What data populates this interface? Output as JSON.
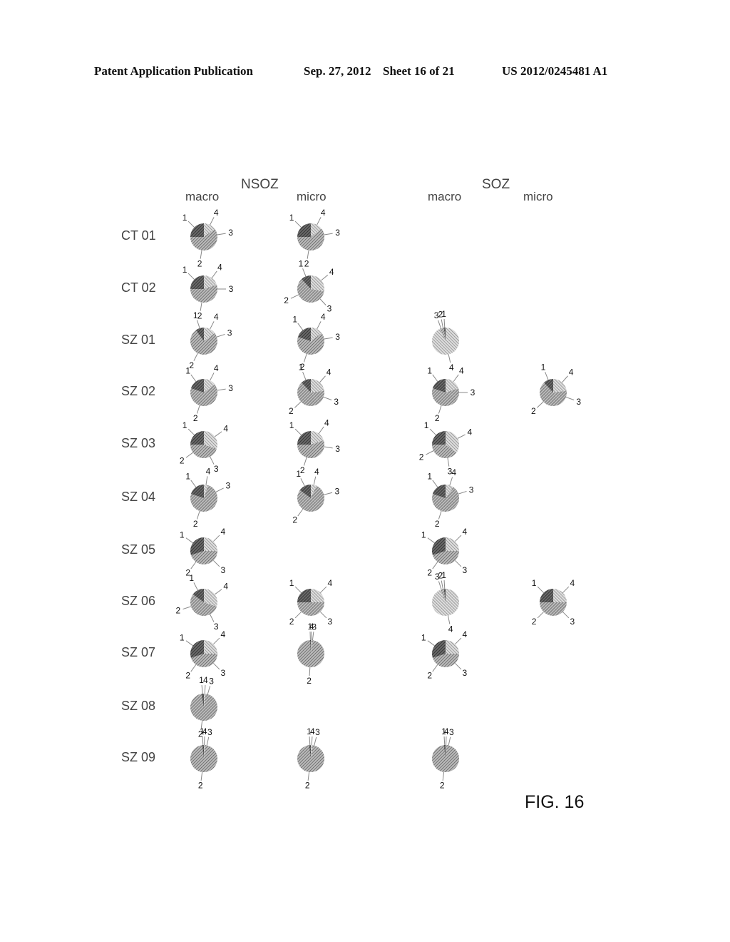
{
  "header": {
    "publication": "Patent Application Publication",
    "date": "Sep. 27, 2012",
    "sheet": "Sheet 16 of 21",
    "number": "US 2012/0245481 A1"
  },
  "figure_label": "FIG. 16",
  "chart_data": {
    "type": "pie",
    "title": "",
    "groups": [
      {
        "name": "NSOZ",
        "subcolumns": [
          "macro",
          "micro"
        ]
      },
      {
        "name": "SOZ",
        "subcolumns": [
          "macro",
          "micro"
        ]
      }
    ],
    "columns": [
      "NSOZ macro",
      "NSOZ micro",
      "SOZ macro",
      "SOZ micro"
    ],
    "slice_labels": [
      "1",
      "2",
      "3",
      "4"
    ],
    "rows": [
      {
        "label": "CT 01",
        "pies": [
          [
            25,
            45,
            15,
            15
          ],
          [
            25,
            45,
            15,
            15
          ],
          null,
          null
        ]
      },
      {
        "label": "CT 02",
        "pies": [
          [
            25,
            45,
            10,
            20
          ],
          [
            12,
            40,
            20,
            28
          ],
          null,
          null
        ]
      },
      {
        "label": "SZ 01",
        "pies": [
          [
            10,
            65,
            10,
            15
          ],
          [
            20,
            50,
            15,
            15
          ],
          [
            2,
            2,
            3,
            93
          ],
          null
        ]
      },
      {
        "label": "SZ 02",
        "pies": [
          [
            20,
            50,
            15,
            15
          ],
          [
            12,
            50,
            15,
            23
          ],
          [
            20,
            50,
            10,
            20
          ],
          [
            12,
            50,
            15,
            23
          ]
        ]
      },
      {
        "label": "SZ 03",
        "pies": [
          [
            25,
            20,
            25,
            30
          ],
          [
            25,
            40,
            15,
            20
          ],
          [
            25,
            15,
            25,
            35
          ],
          null
        ]
      },
      {
        "label": "SZ 04",
        "pies": [
          [
            20,
            50,
            25,
            5
          ],
          [
            15,
            50,
            28,
            7
          ],
          [
            20,
            50,
            20,
            10
          ],
          null
        ]
      },
      {
        "label": "SZ 05",
        "pies": [
          [
            30,
            20,
            25,
            25
          ],
          null,
          [
            30,
            20,
            25,
            25
          ],
          null
        ]
      },
      {
        "label": "SZ 06",
        "pies": [
          [
            15,
            30,
            25,
            30
          ],
          [
            25,
            25,
            25,
            25
          ],
          [
            2,
            2,
            2,
            94
          ],
          [
            25,
            25,
            25,
            25
          ]
        ]
      },
      {
        "label": "SZ 07",
        "pies": [
          [
            30,
            20,
            25,
            25
          ],
          [
            1,
            96,
            2,
            1
          ],
          [
            30,
            20,
            25,
            25
          ],
          null
        ]
      },
      {
        "label": "SZ 08",
        "pies": [
          [
            3,
            90,
            5,
            2
          ],
          null,
          null,
          null
        ]
      },
      {
        "label": "SZ 09",
        "pies": [
          [
            2,
            92,
            5,
            1
          ],
          [
            2,
            92,
            4,
            2
          ],
          [
            2,
            92,
            5,
            1
          ],
          null
        ]
      }
    ]
  }
}
